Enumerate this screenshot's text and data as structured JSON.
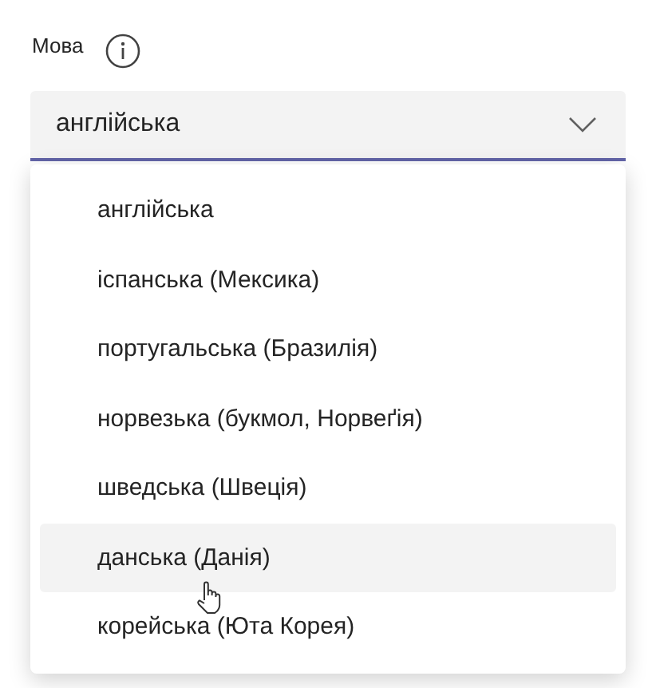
{
  "label": "Мова",
  "select": {
    "value": "англійська",
    "expanded": true
  },
  "options": [
    {
      "label": "англійська",
      "hovered": false
    },
    {
      "label": "іспанська (Мексика)",
      "hovered": false
    },
    {
      "label": "португальська (Бразилія)",
      "hovered": false
    },
    {
      "label": "норвезька (букмол, Норвеґія)",
      "hovered": false
    },
    {
      "label": "шведська (Швеція)",
      "hovered": false
    },
    {
      "label": "данська (Данія)",
      "hovered": true
    },
    {
      "label": "корейська (Юта Корея)",
      "hovered": false
    }
  ]
}
